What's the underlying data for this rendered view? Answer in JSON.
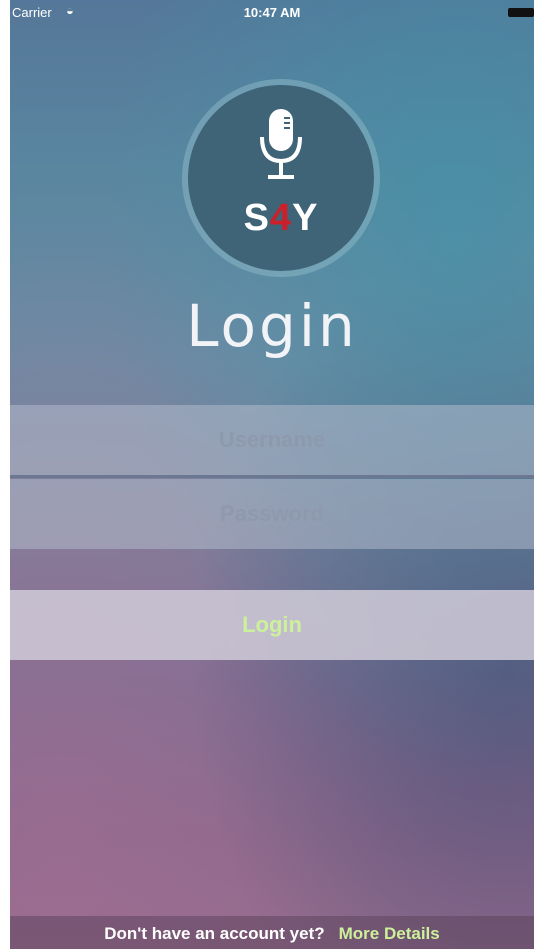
{
  "status_bar": {
    "carrier": "Carrier",
    "time": "10:47 AM"
  },
  "logo": {
    "brand_prefix": "S",
    "brand_digit": "4",
    "brand_suffix": "Y"
  },
  "title": "Login",
  "form": {
    "username_placeholder": "Username",
    "password_placeholder": "Password",
    "login_label": "Login"
  },
  "footer": {
    "question": "Don't have an account yet?",
    "link": "More Details"
  },
  "colors": {
    "accent_green": "#cdf09a",
    "brand_red": "#cc1f2a"
  },
  "icons": [
    "wifi-icon",
    "battery-icon",
    "microphone-icon"
  ]
}
